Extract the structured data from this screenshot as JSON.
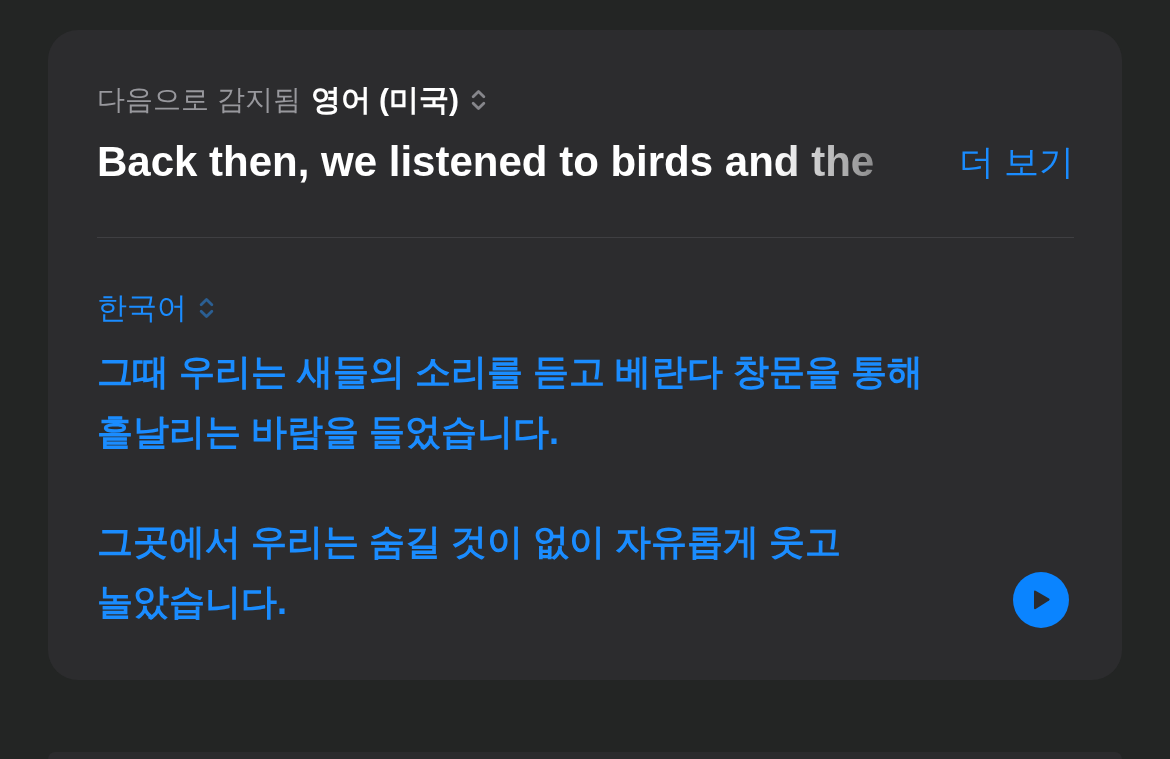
{
  "detected": {
    "label": "다음으로 감지됨",
    "language": "영어 (미국)"
  },
  "source": {
    "text": "Back then, we listened to birds and the",
    "more": "더 보기"
  },
  "target": {
    "language": "한국어",
    "paragraphs": [
      [
        "그때 우리는 새들의 소리를 듣고 베란다 창문을 통해",
        "흩날리는 바람을 들었습니다."
      ],
      [
        "그곳에서 우리는 숨길 것이 없이 자유롭게 웃고",
        "놀았습니다."
      ]
    ]
  }
}
